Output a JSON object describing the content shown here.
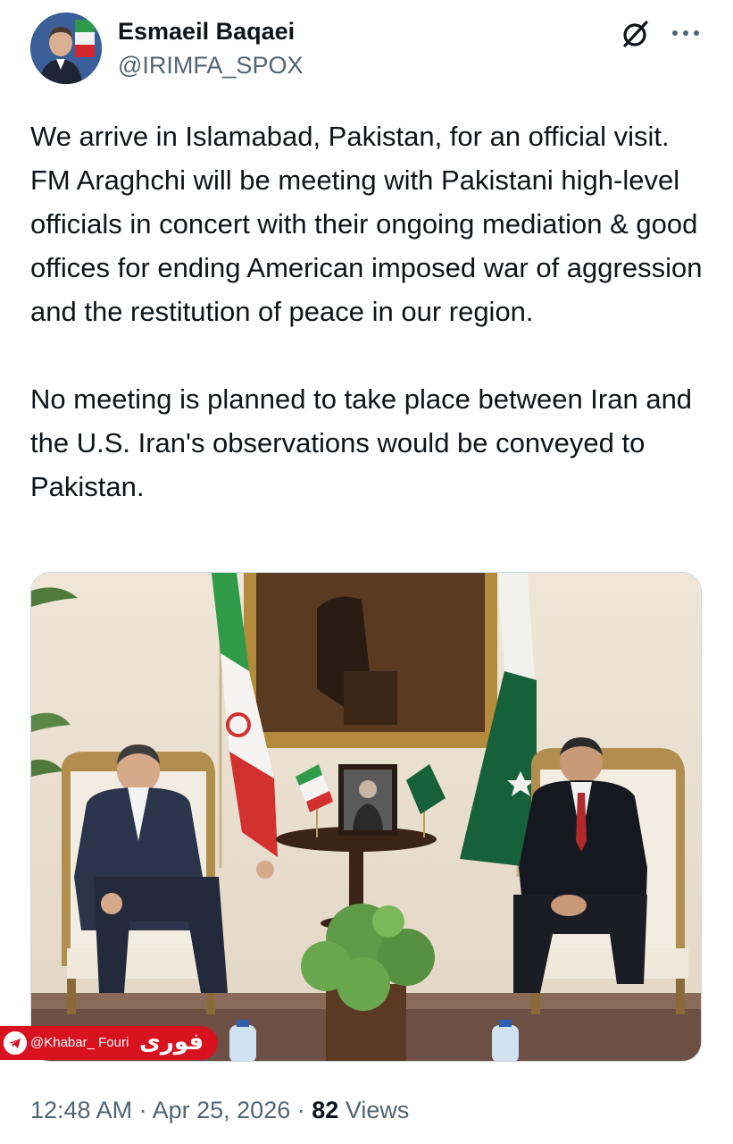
{
  "author": {
    "display_name": "Esmaeil Baqaei",
    "handle": "@IRIMFA_SPOX"
  },
  "tweet": {
    "paragraphs": [
      "We arrive in Islamabad, Pakistan, for an official visit. FM Araghchi will be meeting with Pakistani high-level officials in concert with their ongoing mediation & good offices for ending American imposed war of aggression and the restitution of peace in our region.",
      "No meeting is planned to take place between Iran and the U.S. Iran's observations would be conveyed to Pakistan."
    ]
  },
  "watermark": {
    "handle": "@Khabar_ Fouri",
    "logo_text": "فوری"
  },
  "meta": {
    "time": "12:48 AM",
    "separator": "·",
    "date": "Apr 25, 2026",
    "views_count": "82",
    "views_label": "Views"
  },
  "icons": {
    "grok": "grok-icon",
    "more": "more-dots-icon",
    "telegram": "telegram-icon"
  },
  "colors": {
    "text_primary": "#0f1419",
    "text_secondary": "#536471",
    "watermark_red": "#d8121f"
  }
}
